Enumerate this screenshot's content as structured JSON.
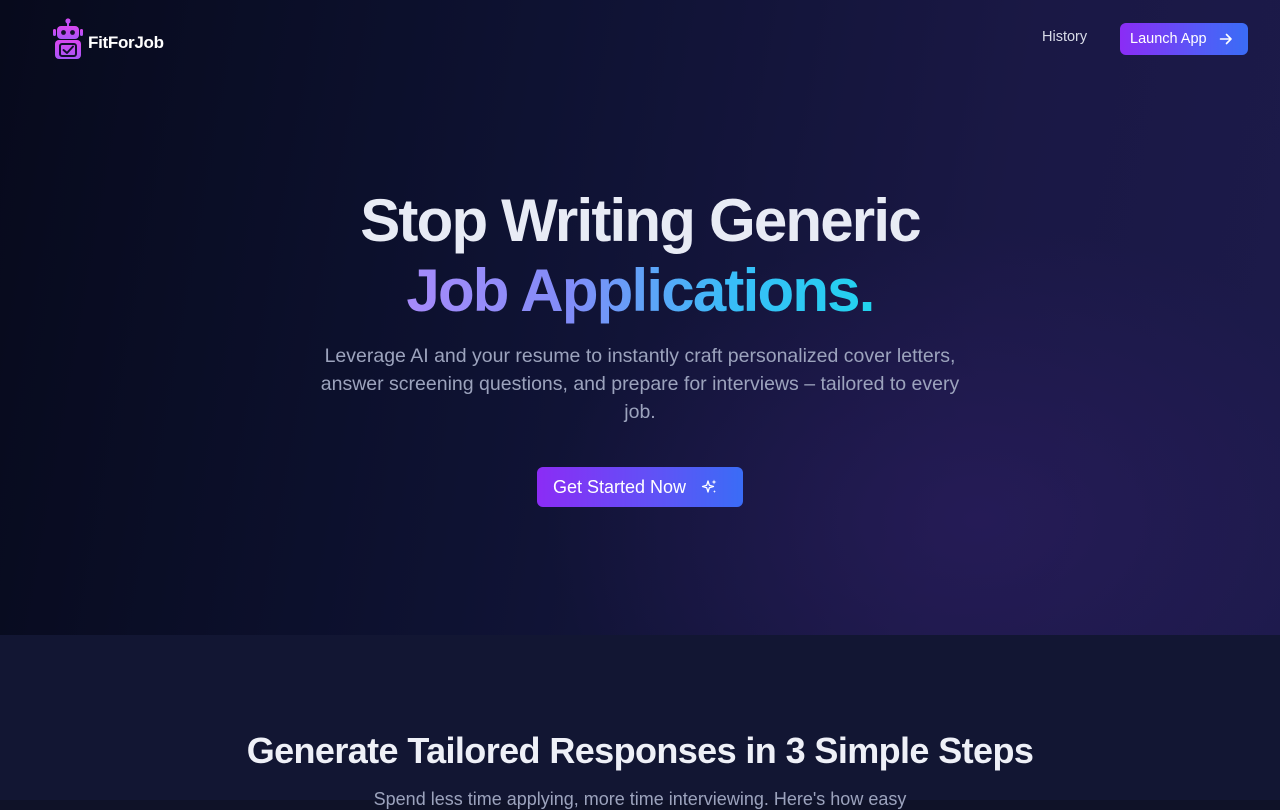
{
  "nav": {
    "brand": "FitForJob",
    "history_label": "History",
    "launch_label": "Launch App"
  },
  "hero": {
    "headline_line1": "Stop Writing Generic",
    "headline_line2": "Job Applications.",
    "subtitle": "Leverage AI and your resume to instantly craft personalized cover letters, answer screening questions, and prepare for interviews – tailored to every job.",
    "cta_label": "Get Started Now"
  },
  "steps": {
    "title": "Generate Tailored Responses in 3 Simple Steps",
    "subtitle": "Spend less time applying, more time interviewing. Here's how easy"
  },
  "icons": {
    "logo": "robot-icon",
    "launch": "arrow-right-icon",
    "cta": "sparkles-icon"
  },
  "colors": {
    "accent_purple": "#8b2cf5",
    "accent_blue": "#3a6cf6",
    "gradient_text_start": "#a78bfa",
    "gradient_text_end": "#22d3ee",
    "background": "#0f1228"
  }
}
